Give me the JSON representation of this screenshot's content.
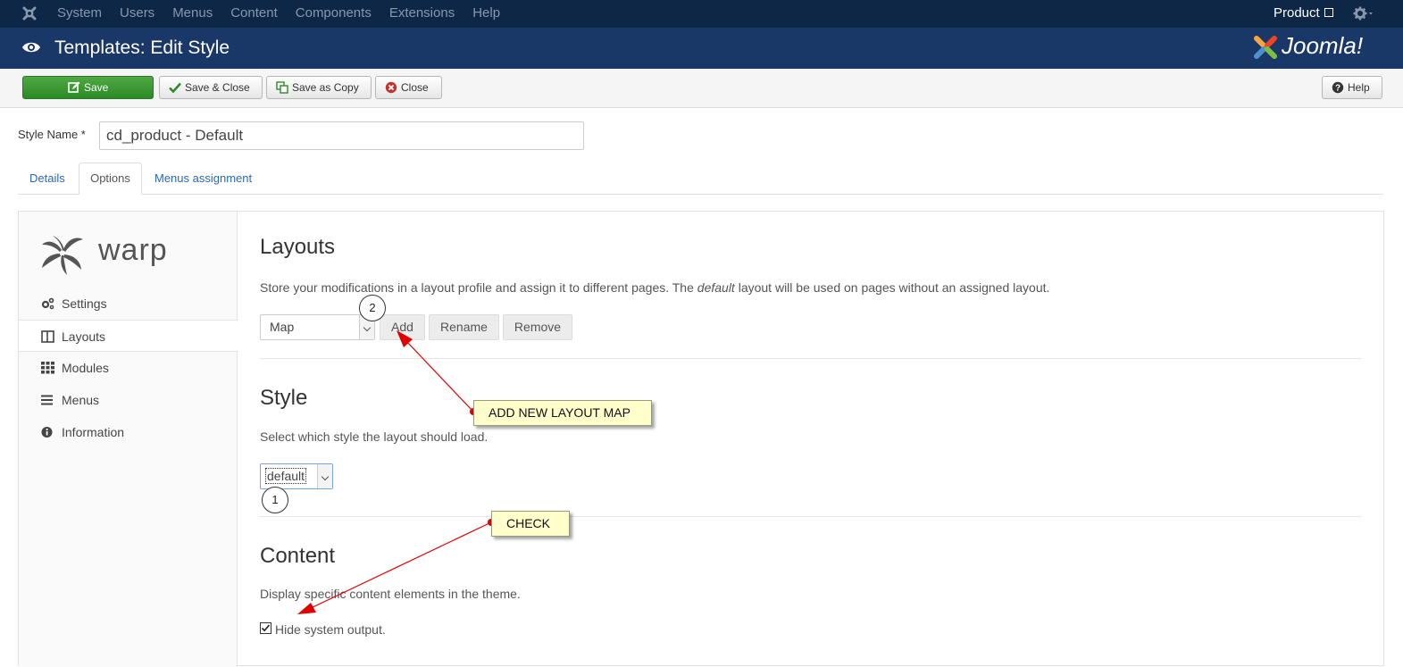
{
  "topbar": {
    "menu": [
      "System",
      "Users",
      "Menus",
      "Content",
      "Components",
      "Extensions",
      "Help"
    ],
    "site_link": "Product"
  },
  "titlebar": {
    "title": "Templates: Edit Style",
    "brand": "Joomla!"
  },
  "toolbar": {
    "save": "Save",
    "save_close": "Save & Close",
    "save_copy": "Save as Copy",
    "close": "Close",
    "help": "Help"
  },
  "form": {
    "style_name_label": "Style Name *",
    "style_name_value": "cd_product - Default"
  },
  "tabs": [
    "Details",
    "Options",
    "Menus assignment"
  ],
  "sidebar": {
    "brand": "warp",
    "items": [
      {
        "label": "Settings",
        "icon": "cogs-icon"
      },
      {
        "label": "Layouts",
        "icon": "columns-icon"
      },
      {
        "label": "Modules",
        "icon": "grid-icon"
      },
      {
        "label": "Menus",
        "icon": "list-icon"
      },
      {
        "label": "Information",
        "icon": "info-icon"
      }
    ]
  },
  "layouts": {
    "heading": "Layouts",
    "desc_before": "Store your modifications in a layout profile and assign it to different pages. The ",
    "desc_em": "default",
    "desc_after": " layout will be used on pages without an assigned layout.",
    "selected": "Map",
    "add": "Add",
    "rename": "Rename",
    "remove": "Remove"
  },
  "style": {
    "heading": "Style",
    "desc": "Select which style the layout should load.",
    "selected": "default"
  },
  "content": {
    "heading": "Content",
    "desc": "Display specific content elements in the theme.",
    "checkbox_label": "Hide system output.",
    "checked": true
  },
  "annotations": {
    "marker_1": "1",
    "marker_2": "2",
    "note_layout": "ADD NEW LAYOUT MAP",
    "note_check": "CHECK"
  },
  "colors": {
    "topbar": "#0f2747",
    "titlebar": "#1a3867",
    "save_green": "#2b8a25",
    "link_blue": "#2a69b8",
    "arrow_red": "#e00000",
    "note_yellow": "#ffffcc"
  }
}
